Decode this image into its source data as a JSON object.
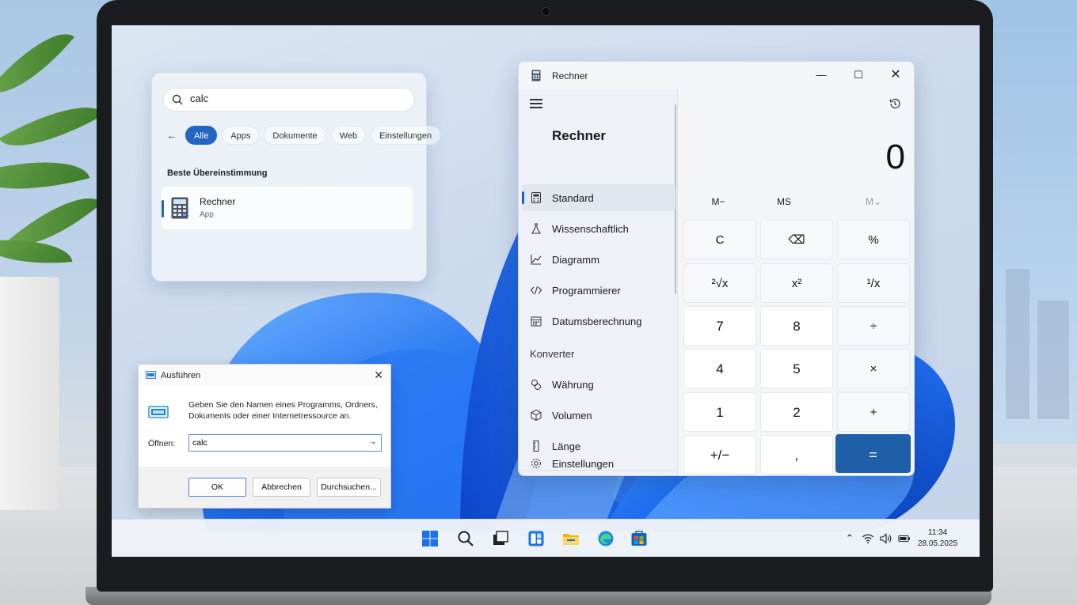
{
  "search": {
    "query": "calc",
    "filters": [
      "Alle",
      "Apps",
      "Dokumente",
      "Web",
      "Einstellungen"
    ],
    "best_match_label": "Beste Übereinstimmung",
    "result_name": "Rechner",
    "result_type": "App"
  },
  "calculator": {
    "window_title": "Rechner",
    "nav_title": "Rechner",
    "nav_items": [
      "Standard",
      "Wissenschaftlich",
      "Diagramm",
      "Programmierer",
      "Datumsberechnung"
    ],
    "converter_heading": "Konverter",
    "converter_items": [
      "Währung",
      "Volumen",
      "Länge"
    ],
    "settings_label": "Einstellungen",
    "display": "0",
    "memory": [
      "M−",
      "MS",
      "M⌄"
    ],
    "keys": [
      "C",
      "⌫",
      "%",
      "²√x",
      "x²",
      "¹/x",
      "7",
      "8",
      "÷",
      "4",
      "5",
      "×",
      "1",
      "2",
      "+",
      "+/−",
      ",",
      "="
    ]
  },
  "run_dialog": {
    "title": "Ausführen",
    "description": "Geben Sie den Namen eines Programms, Ordners, Dokuments oder einer Internetressource an.",
    "open_label": "Öffnen:",
    "input_value": "calc",
    "ok_label": "OK",
    "cancel_label": "Abbrechen",
    "browse_label": "Durchsuchen..."
  },
  "taskbar": {
    "time": "11:34",
    "date": "28.05.2025",
    "icons": [
      "windows-start-icon",
      "search-icon",
      "task-view-icon",
      "widgets-icon",
      "file-explorer-icon",
      "edge-icon",
      "store-icon"
    ]
  },
  "colors": {
    "accent": "#2464c4",
    "equals_key": "#1f5fa8",
    "bloom": "#1f6ff0"
  }
}
